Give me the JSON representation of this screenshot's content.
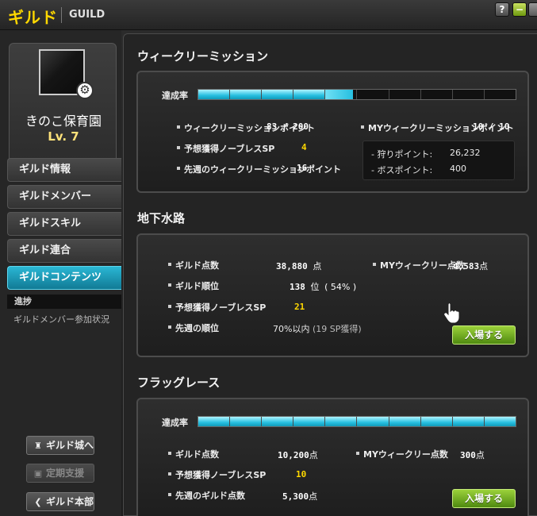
{
  "window": {
    "title_jp": "ギルド",
    "title_en": "GUILD",
    "help_glyph": "?",
    "minimize_glyph": "−",
    "colors": {
      "title": "#ffd800",
      "accent": "#2ab7d4",
      "highlight": "#ffd800",
      "enter_button": "#7ab526"
    }
  },
  "profile": {
    "guild_name": "きのこ保育園",
    "level": "Lv. 7",
    "emblem_icon": "guild-emblem",
    "settings_icon": "gear-icon"
  },
  "menu": {
    "items": [
      {
        "label": "ギルド情報",
        "active": false
      },
      {
        "label": "ギルドメンバー",
        "active": false
      },
      {
        "label": "ギルドスキル",
        "active": false
      },
      {
        "label": "ギルド連合",
        "active": false
      },
      {
        "label": "ギルドコンテンツ",
        "active": true
      }
    ],
    "sub_header": "進捗",
    "sub_item": "ギルドメンバー参加状況"
  },
  "bottom_buttons": [
    {
      "label": "ギルド城へ",
      "icon": "castle-icon",
      "enabled": true
    },
    {
      "label": "定期支援",
      "icon": "gift-icon",
      "enabled": false
    },
    {
      "label": "ギルド本部",
      "icon": "chevron-left-icon",
      "enabled": true
    }
  ],
  "weekly": {
    "title": "ウィークリーミッション",
    "progress_label": "達成率",
    "progress_fraction": 0.415,
    "points_label": "ウィークリーミッションポイント",
    "points_value": "83 / 200",
    "sp_label": "予想獲得ノーブレスSP",
    "sp_value": "4",
    "last_week_label": "先週のウィークリーミッションポイント",
    "last_week_value": "16",
    "my_points_label": "MYウィークリーミッションポイント",
    "my_points_value": "10 / 10",
    "hunt_label": "- 狩りポイント:",
    "hunt_value": "26,232",
    "boss_label": "- ボスポイント:",
    "boss_value": "400"
  },
  "underground": {
    "title": "地下水路",
    "score_label": "ギルド点数",
    "score_value": "38,880",
    "score_unit": "点",
    "rank_label": "ギルド順位",
    "rank_value": "138",
    "rank_unit": "位",
    "rank_pct": "( 54% )",
    "sp_label": "予想獲得ノーブレスSP",
    "sp_value": "21",
    "last_rank_label": "先週の順位",
    "last_rank_value": "70%以内",
    "last_rank_note": "(19 SP獲得)",
    "my_weekly_label": "MYウィークリー点数",
    "my_weekly_value": "4,583",
    "my_weekly_unit": "点",
    "enter_label": "入場する"
  },
  "flag_race": {
    "title": "フラッグレース",
    "progress_label": "達成率",
    "progress_fraction": 1.0,
    "score_label": "ギルド点数",
    "score_value": "10,200",
    "score_unit": "点",
    "sp_label": "予想獲得ノーブレスSP",
    "sp_value": "10",
    "last_score_label": "先週のギルド点数",
    "last_score_value": "5,300",
    "last_score_unit": "点",
    "my_weekly_label": "MYウィークリー点数",
    "my_weekly_value": "300",
    "my_weekly_unit": "点",
    "enter_label": "入場する"
  }
}
